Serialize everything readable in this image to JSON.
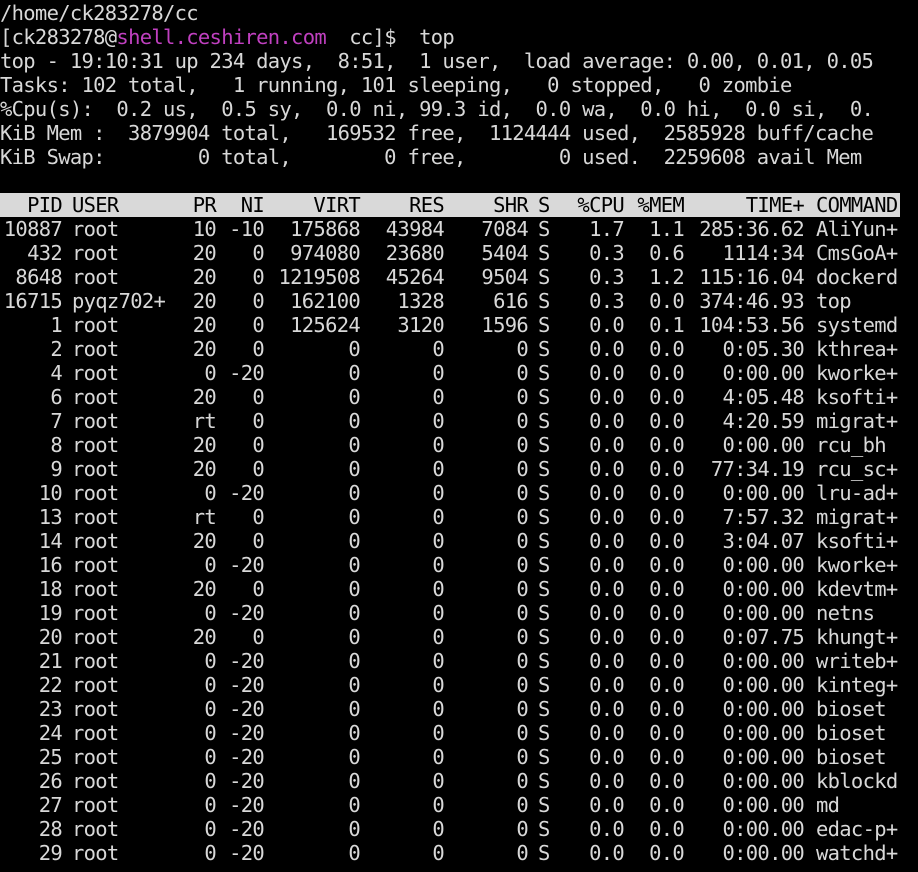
{
  "terminal": {
    "path": "/home/ck283278/cc",
    "prompt": {
      "user_part": "[ck283278@",
      "host": "shell.ceshiren.com",
      "dir_part": "  cc]$  ",
      "command": "top"
    },
    "summary": {
      "uptime": "top - 19:10:31 up 234 days,  8:51,  1 user,  load average: 0.00, 0.01, 0.05",
      "tasks": "Tasks: 102 total,   1 running, 101 sleeping,   0 stopped,   0 zombie",
      "cpu": "%Cpu(s):  0.2 us,  0.5 sy,  0.0 ni, 99.3 id,  0.0 wa,  0.0 hi,  0.0 si,  0.",
      "mem": "KiB Mem :  3879904 total,   169532 free,  1124444 used,  2585928 buff/cache",
      "swap": "KiB Swap:        0 total,        0 free,        0 used.  2259608 avail Mem"
    },
    "table": {
      "headers": {
        "pid": "PID",
        "user": "USER",
        "pr": "PR",
        "ni": "NI",
        "virt": "VIRT",
        "res": "RES",
        "shr": "SHR",
        "s": "S",
        "cpu": "%CPU",
        "mem": "%MEM",
        "time": "TIME+",
        "command": "COMMAND"
      },
      "rows": [
        {
          "pid": "10887",
          "user": "root",
          "pr": "10",
          "ni": "-10",
          "virt": "175868",
          "res": "43984",
          "shr": "7084",
          "s": "S",
          "cpu": "1.7",
          "mem": "1.1",
          "time": "285:36.62",
          "command": "AliYun+"
        },
        {
          "pid": "432",
          "user": "root",
          "pr": "20",
          "ni": "0",
          "virt": "974080",
          "res": "23680",
          "shr": "5404",
          "s": "S",
          "cpu": "0.3",
          "mem": "0.6",
          "time": "1114:34",
          "command": "CmsGoA+"
        },
        {
          "pid": "8648",
          "user": "root",
          "pr": "20",
          "ni": "0",
          "virt": "1219508",
          "res": "45264",
          "shr": "9504",
          "s": "S",
          "cpu": "0.3",
          "mem": "1.2",
          "time": "115:16.04",
          "command": "dockerd"
        },
        {
          "pid": "16715",
          "user": "pyqz702+",
          "pr": "20",
          "ni": "0",
          "virt": "162100",
          "res": "1328",
          "shr": "616",
          "s": "S",
          "cpu": "0.3",
          "mem": "0.0",
          "time": "374:46.93",
          "command": "top"
        },
        {
          "pid": "1",
          "user": "root",
          "pr": "20",
          "ni": "0",
          "virt": "125624",
          "res": "3120",
          "shr": "1596",
          "s": "S",
          "cpu": "0.0",
          "mem": "0.1",
          "time": "104:53.56",
          "command": "systemd"
        },
        {
          "pid": "2",
          "user": "root",
          "pr": "20",
          "ni": "0",
          "virt": "0",
          "res": "0",
          "shr": "0",
          "s": "S",
          "cpu": "0.0",
          "mem": "0.0",
          "time": "0:05.30",
          "command": "kthrea+"
        },
        {
          "pid": "4",
          "user": "root",
          "pr": "0",
          "ni": "-20",
          "virt": "0",
          "res": "0",
          "shr": "0",
          "s": "S",
          "cpu": "0.0",
          "mem": "0.0",
          "time": "0:00.00",
          "command": "kworke+"
        },
        {
          "pid": "6",
          "user": "root",
          "pr": "20",
          "ni": "0",
          "virt": "0",
          "res": "0",
          "shr": "0",
          "s": "S",
          "cpu": "0.0",
          "mem": "0.0",
          "time": "4:05.48",
          "command": "ksofti+"
        },
        {
          "pid": "7",
          "user": "root",
          "pr": "rt",
          "ni": "0",
          "virt": "0",
          "res": "0",
          "shr": "0",
          "s": "S",
          "cpu": "0.0",
          "mem": "0.0",
          "time": "4:20.59",
          "command": "migrat+"
        },
        {
          "pid": "8",
          "user": "root",
          "pr": "20",
          "ni": "0",
          "virt": "0",
          "res": "0",
          "shr": "0",
          "s": "S",
          "cpu": "0.0",
          "mem": "0.0",
          "time": "0:00.00",
          "command": "rcu_bh"
        },
        {
          "pid": "9",
          "user": "root",
          "pr": "20",
          "ni": "0",
          "virt": "0",
          "res": "0",
          "shr": "0",
          "s": "S",
          "cpu": "0.0",
          "mem": "0.0",
          "time": "77:34.19",
          "command": "rcu_sc+"
        },
        {
          "pid": "10",
          "user": "root",
          "pr": "0",
          "ni": "-20",
          "virt": "0",
          "res": "0",
          "shr": "0",
          "s": "S",
          "cpu": "0.0",
          "mem": "0.0",
          "time": "0:00.00",
          "command": "lru-ad+"
        },
        {
          "pid": "13",
          "user": "root",
          "pr": "rt",
          "ni": "0",
          "virt": "0",
          "res": "0",
          "shr": "0",
          "s": "S",
          "cpu": "0.0",
          "mem": "0.0",
          "time": "7:57.32",
          "command": "migrat+"
        },
        {
          "pid": "14",
          "user": "root",
          "pr": "20",
          "ni": "0",
          "virt": "0",
          "res": "0",
          "shr": "0",
          "s": "S",
          "cpu": "0.0",
          "mem": "0.0",
          "time": "3:04.07",
          "command": "ksofti+"
        },
        {
          "pid": "16",
          "user": "root",
          "pr": "0",
          "ni": "-20",
          "virt": "0",
          "res": "0",
          "shr": "0",
          "s": "S",
          "cpu": "0.0",
          "mem": "0.0",
          "time": "0:00.00",
          "command": "kworke+"
        },
        {
          "pid": "18",
          "user": "root",
          "pr": "20",
          "ni": "0",
          "virt": "0",
          "res": "0",
          "shr": "0",
          "s": "S",
          "cpu": "0.0",
          "mem": "0.0",
          "time": "0:00.00",
          "command": "kdevtm+"
        },
        {
          "pid": "19",
          "user": "root",
          "pr": "0",
          "ni": "-20",
          "virt": "0",
          "res": "0",
          "shr": "0",
          "s": "S",
          "cpu": "0.0",
          "mem": "0.0",
          "time": "0:00.00",
          "command": "netns"
        },
        {
          "pid": "20",
          "user": "root",
          "pr": "20",
          "ni": "0",
          "virt": "0",
          "res": "0",
          "shr": "0",
          "s": "S",
          "cpu": "0.0",
          "mem": "0.0",
          "time": "0:07.75",
          "command": "khungt+"
        },
        {
          "pid": "21",
          "user": "root",
          "pr": "0",
          "ni": "-20",
          "virt": "0",
          "res": "0",
          "shr": "0",
          "s": "S",
          "cpu": "0.0",
          "mem": "0.0",
          "time": "0:00.00",
          "command": "writeb+"
        },
        {
          "pid": "22",
          "user": "root",
          "pr": "0",
          "ni": "-20",
          "virt": "0",
          "res": "0",
          "shr": "0",
          "s": "S",
          "cpu": "0.0",
          "mem": "0.0",
          "time": "0:00.00",
          "command": "kinteg+"
        },
        {
          "pid": "23",
          "user": "root",
          "pr": "0",
          "ni": "-20",
          "virt": "0",
          "res": "0",
          "shr": "0",
          "s": "S",
          "cpu": "0.0",
          "mem": "0.0",
          "time": "0:00.00",
          "command": "bioset"
        },
        {
          "pid": "24",
          "user": "root",
          "pr": "0",
          "ni": "-20",
          "virt": "0",
          "res": "0",
          "shr": "0",
          "s": "S",
          "cpu": "0.0",
          "mem": "0.0",
          "time": "0:00.00",
          "command": "bioset"
        },
        {
          "pid": "25",
          "user": "root",
          "pr": "0",
          "ni": "-20",
          "virt": "0",
          "res": "0",
          "shr": "0",
          "s": "S",
          "cpu": "0.0",
          "mem": "0.0",
          "time": "0:00.00",
          "command": "bioset"
        },
        {
          "pid": "26",
          "user": "root",
          "pr": "0",
          "ni": "-20",
          "virt": "0",
          "res": "0",
          "shr": "0",
          "s": "S",
          "cpu": "0.0",
          "mem": "0.0",
          "time": "0:00.00",
          "command": "kblockd"
        },
        {
          "pid": "27",
          "user": "root",
          "pr": "0",
          "ni": "-20",
          "virt": "0",
          "res": "0",
          "shr": "0",
          "s": "S",
          "cpu": "0.0",
          "mem": "0.0",
          "time": "0:00.00",
          "command": "md"
        },
        {
          "pid": "28",
          "user": "root",
          "pr": "0",
          "ni": "-20",
          "virt": "0",
          "res": "0",
          "shr": "0",
          "s": "S",
          "cpu": "0.0",
          "mem": "0.0",
          "time": "0:00.00",
          "command": "edac-p+"
        },
        {
          "pid": "29",
          "user": "root",
          "pr": "0",
          "ni": "-20",
          "virt": "0",
          "res": "0",
          "shr": "0",
          "s": "S",
          "cpu": "0.0",
          "mem": "0.0",
          "time": "0:00.00",
          "command": "watchd+"
        }
      ]
    },
    "colors": {
      "background": "#000000",
      "foreground": "#d8d8d8",
      "host": "#c040c0",
      "header_bg": "#d9d9d9"
    }
  }
}
